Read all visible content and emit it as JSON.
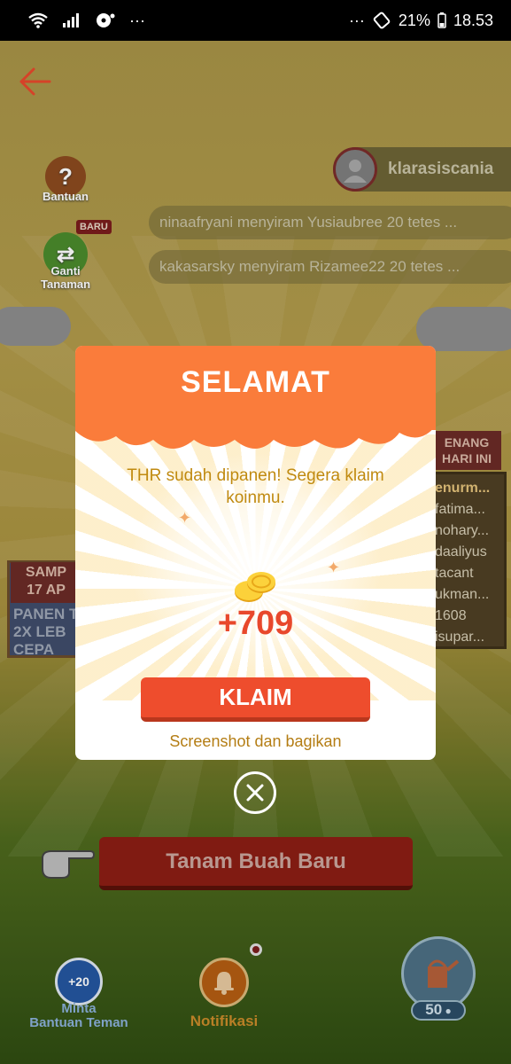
{
  "status_bar": {
    "battery": "21%",
    "time": "18.53",
    "more": "···",
    "more_right": "···"
  },
  "game": {
    "help_label": "Bantuan",
    "change_plant_label_1": "Ganti",
    "change_plant_label_2": "Tanaman",
    "new_badge": "BARU",
    "username": "klarasiscania",
    "feed": [
      "ninaafryani menyiram Yusiaubree 20 tetes ...",
      "kakasarsky menyiram Rizamee22 20 tetes ..."
    ],
    "board_left_top": "SAMP\n17 AP",
    "board_left_body": "PANEN T\n2X LEB\nCEPA",
    "board_right_head": "ENANG\nHARI INI",
    "board_right_list": [
      "enurm...",
      "fatima...",
      "nohary...",
      "daaliyus",
      "tacant",
      "ukman...",
      "1608",
      "isupar..."
    ],
    "plant_button": "Tanam Buah Baru",
    "bottom": {
      "help_friend_1": "Minta",
      "help_friend_2": "Bantuan Teman",
      "help_friend_badge": "+20",
      "notif": "Notifikasi",
      "water_count": "50"
    }
  },
  "modal": {
    "title": "SELAMAT",
    "message": "THR sudah dipanen! Segera klaim koinmu.",
    "amount": "+709",
    "claim_button": "KLAIM",
    "share_link": "Screenshot dan bagikan"
  }
}
